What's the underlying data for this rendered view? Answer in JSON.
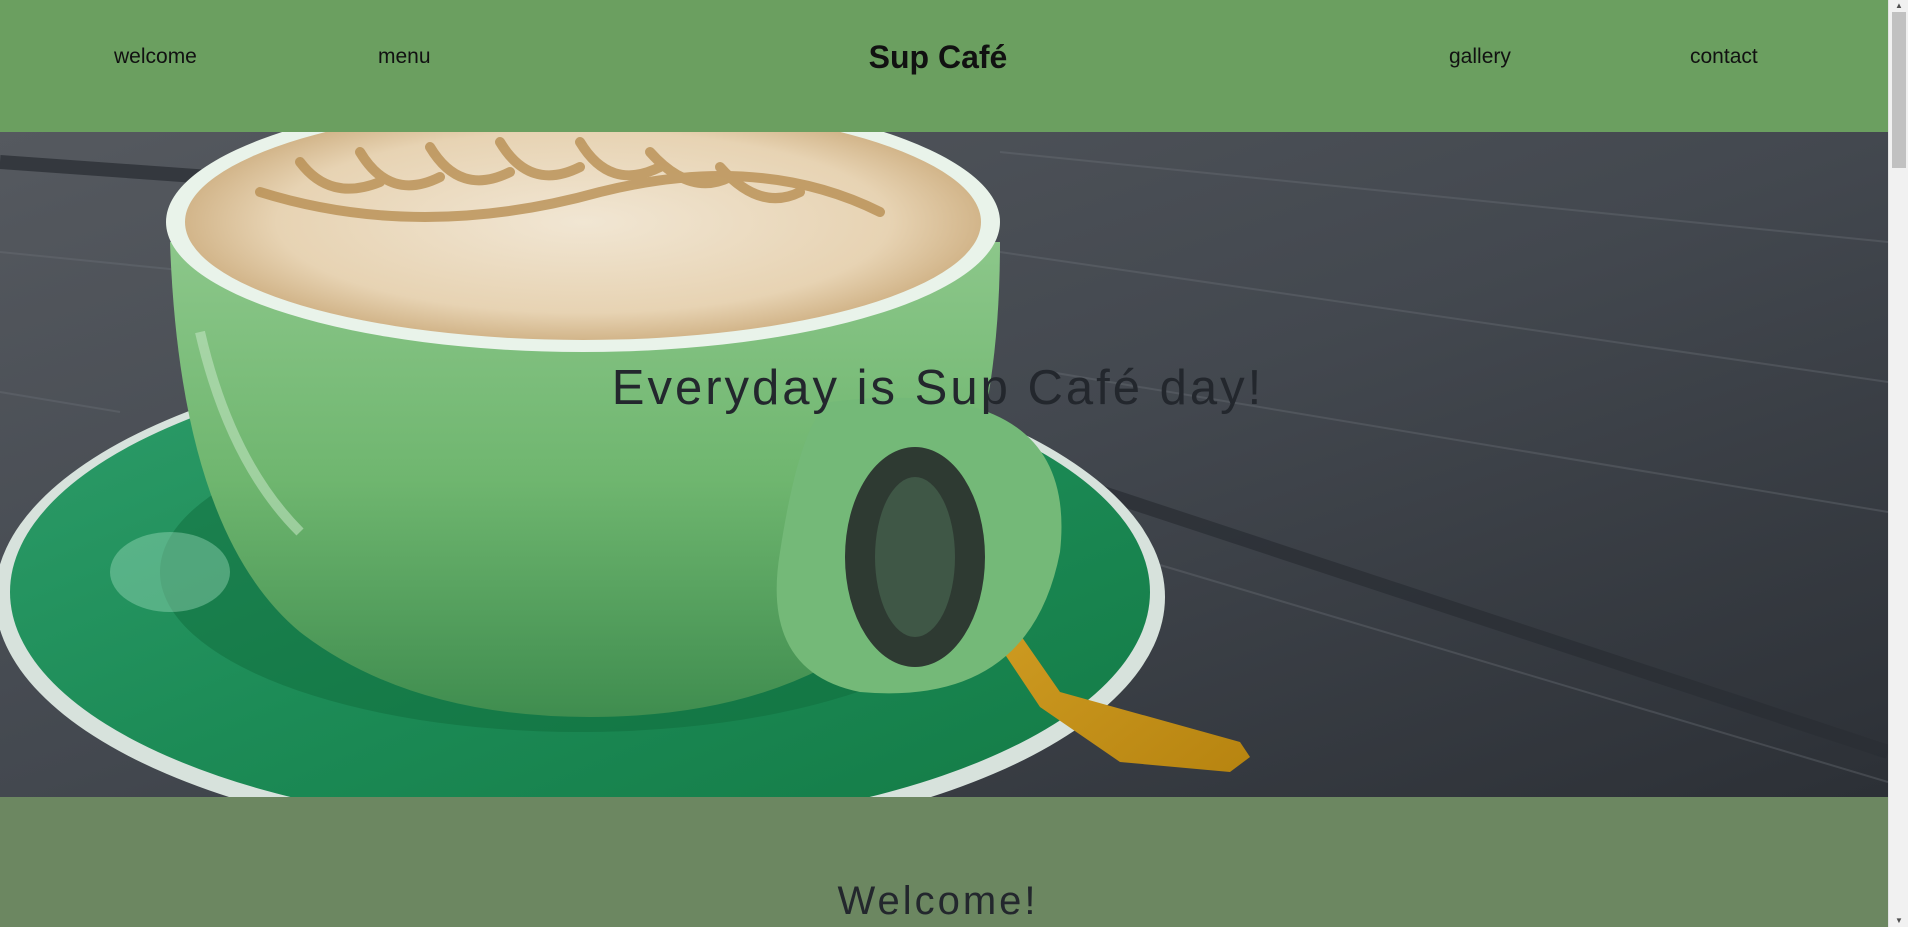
{
  "nav": {
    "welcome": "welcome",
    "menu": "menu",
    "brand": "Sup Café",
    "gallery": "gallery",
    "contact": "contact"
  },
  "hero": {
    "tagline": "Everyday is Sup Café day!"
  },
  "welcome_section": {
    "heading": "Welcome!"
  },
  "scrollbar": {
    "up_icon": "▲",
    "down_icon": "▼"
  },
  "colors": {
    "nav_bg": "#6b9f60",
    "section_bg": "#6c8761",
    "text": "#23272d"
  }
}
